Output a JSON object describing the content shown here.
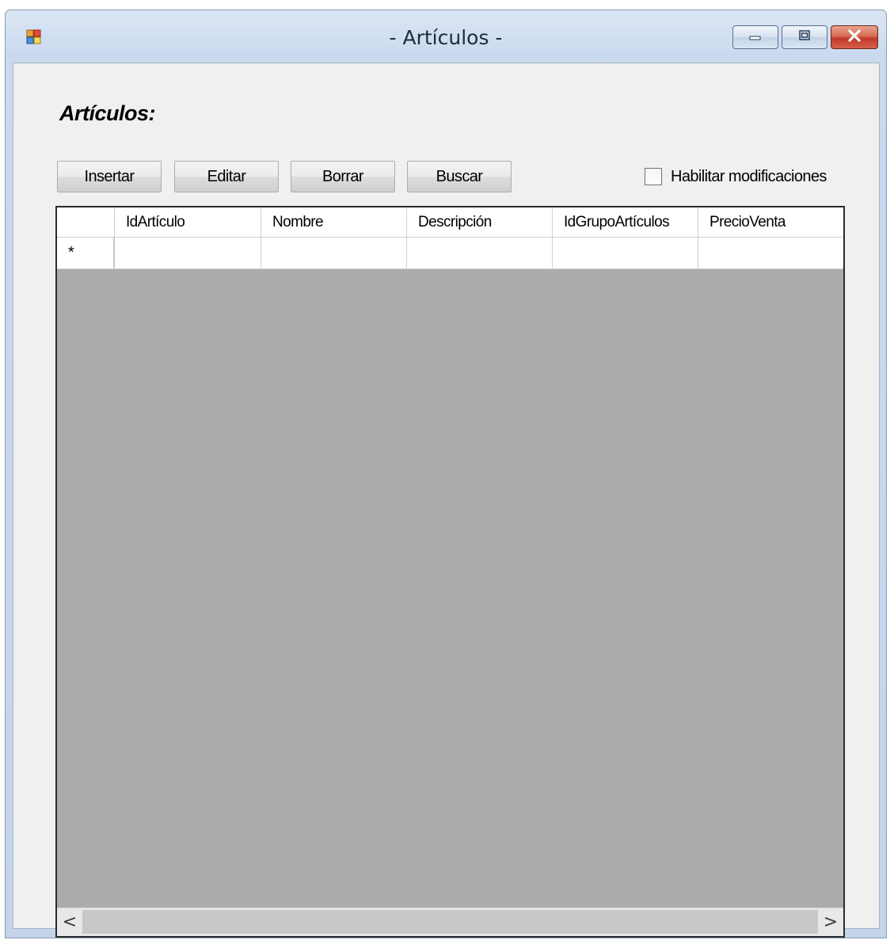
{
  "window": {
    "title": "- Artículos -"
  },
  "form": {
    "heading": "Artículos:"
  },
  "toolbar": {
    "insert_label": "Insertar",
    "edit_label": "Editar",
    "delete_label": "Borrar",
    "search_label": "Buscar",
    "enable_edit_label": "Habilitar modificaciones",
    "enable_edit_checked": false
  },
  "grid": {
    "columns": [
      "IdArtículo",
      "Nombre",
      "Descripción",
      "IdGrupoArtículos",
      "PrecioVenta"
    ],
    "new_row_marker": "*",
    "rows": []
  },
  "scrollbar": {
    "left_glyph": "<",
    "right_glyph": ">"
  },
  "colors": {
    "grid_background": "#ababab",
    "client_background": "#f0f0f0",
    "close_button": "#c0392b"
  }
}
